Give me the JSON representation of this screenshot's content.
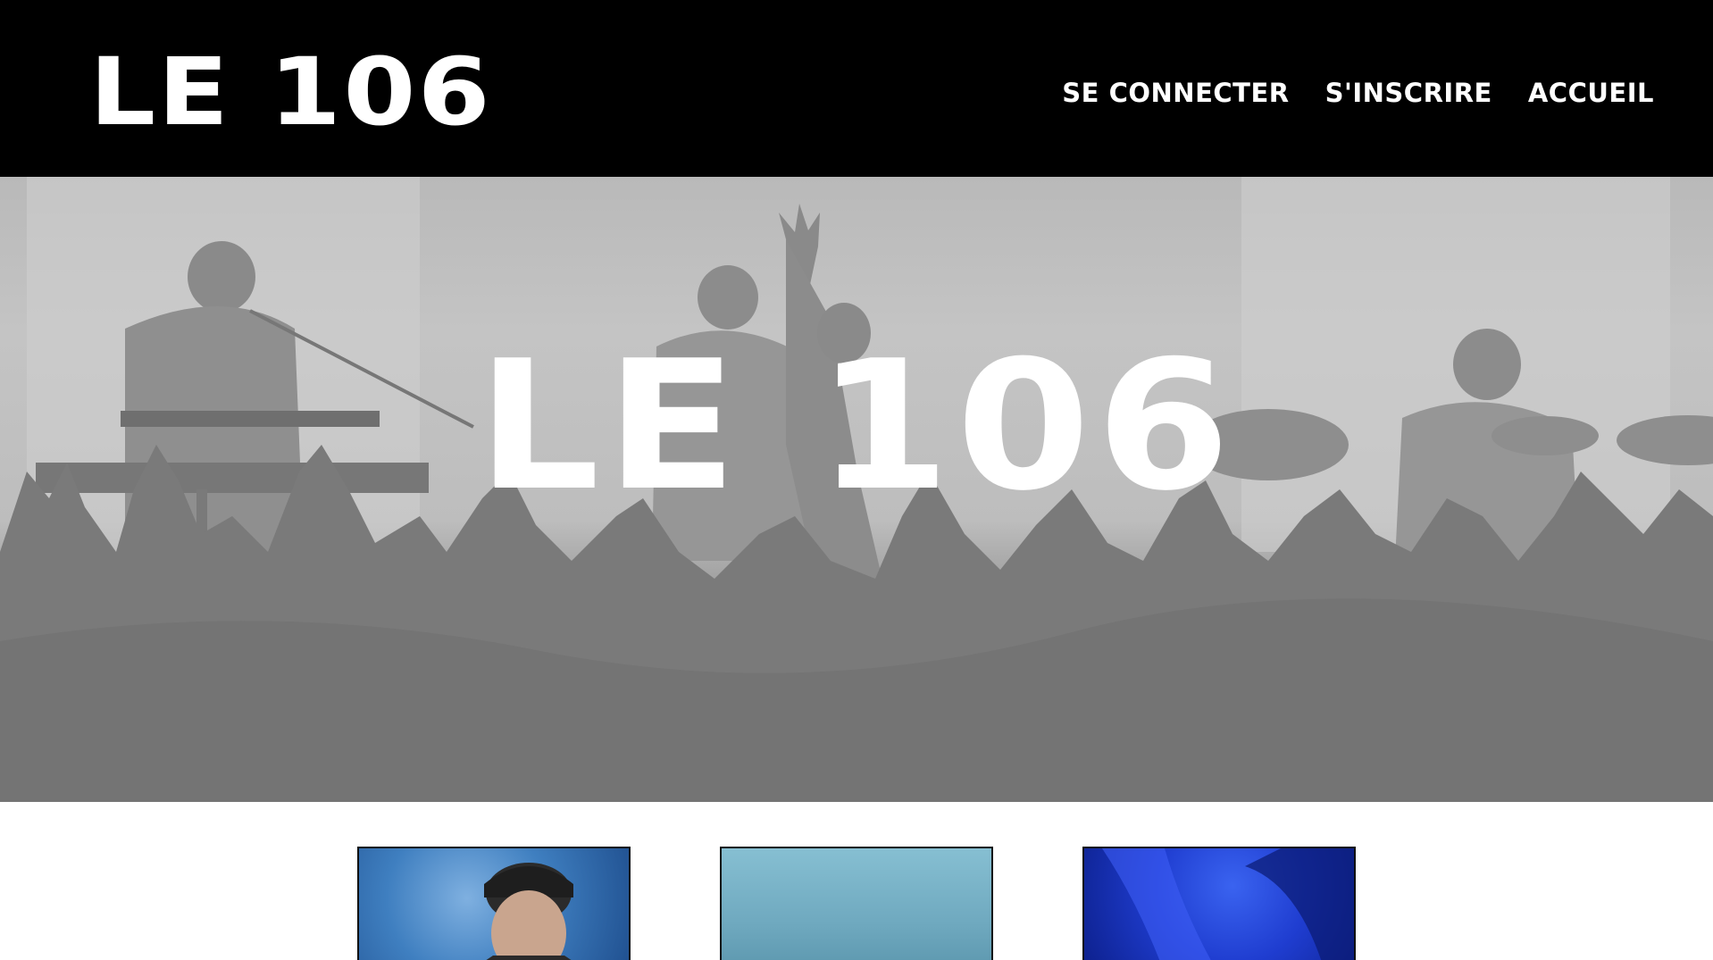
{
  "header": {
    "logo": "LE 106",
    "nav": [
      {
        "label": "SE CONNECTER"
      },
      {
        "label": "S'INSCRIRE"
      },
      {
        "label": "ACCUEIL"
      }
    ]
  },
  "hero": {
    "title": "LE 106",
    "image": "concert-crowd-silhouette"
  },
  "cards": [
    {
      "image": "artist-portrait-cap-blue"
    },
    {
      "image": "artist-image-light-blue"
    },
    {
      "image": "artist-image-deep-blue"
    }
  ],
  "colors": {
    "header_bg": "#000000",
    "text": "#ffffff",
    "hero_gray": "#7a7a7a"
  }
}
